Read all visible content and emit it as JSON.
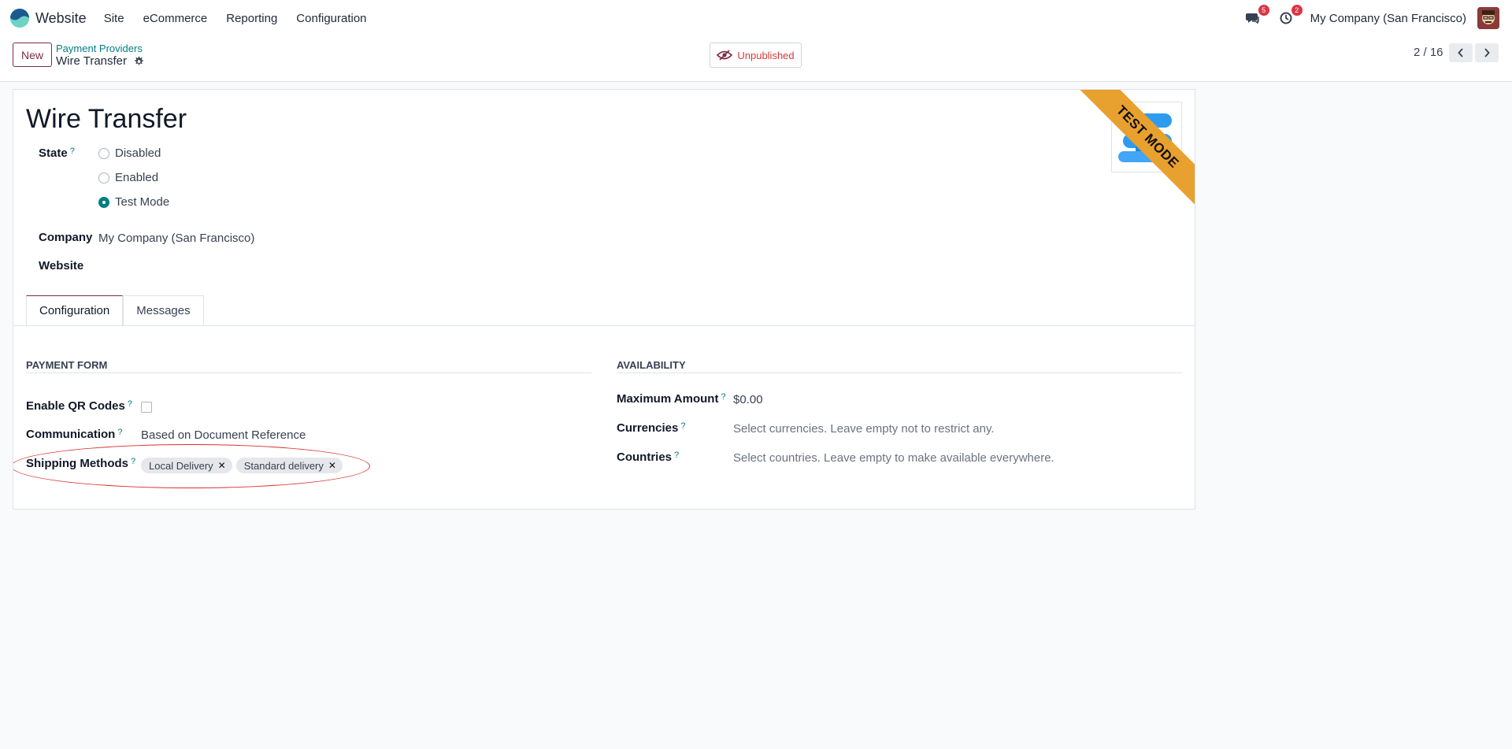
{
  "nav": {
    "app_name": "Website",
    "menu": [
      "Site",
      "eCommerce",
      "Reporting",
      "Configuration"
    ],
    "messages_count": "5",
    "activities_count": "2",
    "company": "My Company (San Francisco)"
  },
  "control": {
    "new_label": "New",
    "breadcrumb_parent": "Payment Providers",
    "breadcrumb_current": "Wire Transfer",
    "publish_status": "Unpublished",
    "pager": "2 / 16"
  },
  "form": {
    "title": "Wire Transfer",
    "ribbon": "TEST MODE",
    "state_label": "State",
    "state_help": "?",
    "state_options": [
      "Disabled",
      "Enabled",
      "Test Mode"
    ],
    "state_selected": "Test Mode",
    "company_label": "Company",
    "company_value": "My Company (San Francisco)",
    "website_label": "Website",
    "website_value": ""
  },
  "tabs": [
    "Configuration",
    "Messages"
  ],
  "payment_form": {
    "title": "PAYMENT FORM",
    "enable_qr_label": "Enable QR Codes",
    "enable_qr_checked": false,
    "communication_label": "Communication",
    "communication_value": "Based on Document Reference",
    "shipping_label": "Shipping Methods",
    "shipping_tags": [
      "Local Delivery",
      "Standard delivery"
    ]
  },
  "availability": {
    "title": "AVAILABILITY",
    "max_amount_label": "Maximum Amount",
    "max_amount_value": "$0.00",
    "currencies_label": "Currencies",
    "currencies_placeholder": "Select currencies. Leave empty not to restrict any.",
    "countries_label": "Countries",
    "countries_placeholder": "Select countries. Leave empty to make available everywhere."
  },
  "colors": {
    "accent": "#7c2c4a",
    "teal": "#017e84",
    "ribbon": "#e8a02e",
    "annotation": "#d9302f"
  }
}
